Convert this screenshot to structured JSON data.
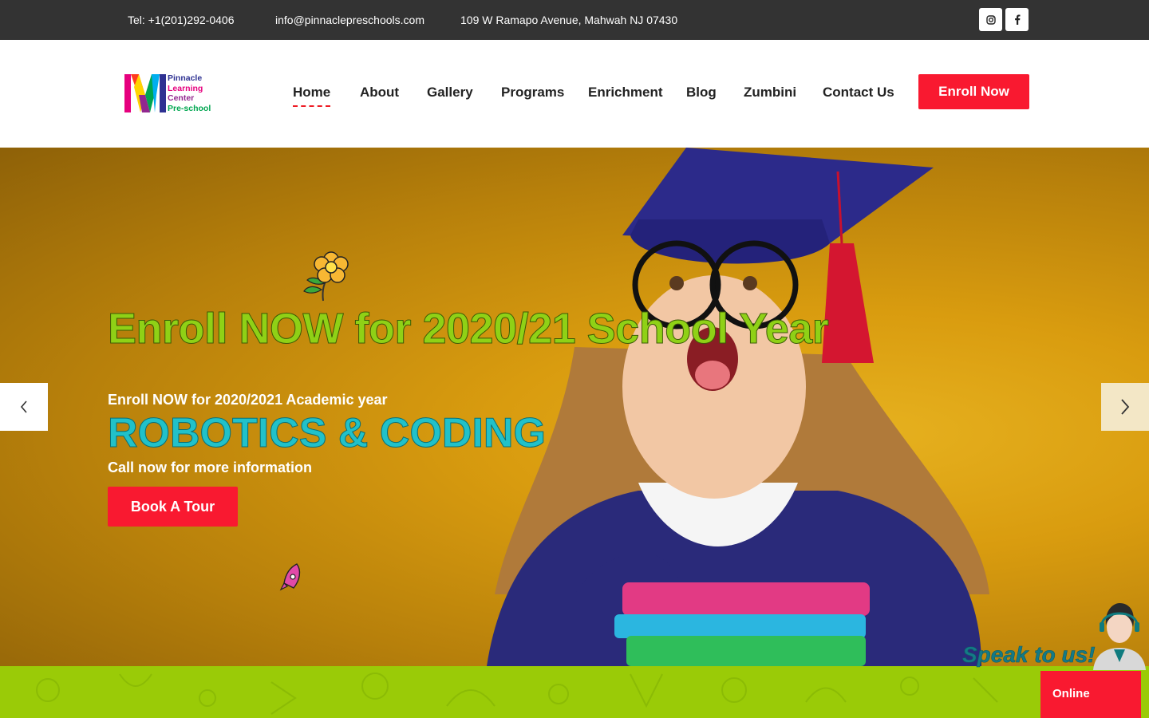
{
  "topbar": {
    "phone": "Tel: +1(201)292-0406",
    "email": "info@pinnaclepreschools.com",
    "address": "109 W Ramapo Avenue, Mahwah NJ 07430",
    "social": [
      "instagram-icon",
      "facebook-icon"
    ]
  },
  "logo": {
    "line1": "Pinnacle",
    "line2": "Learning",
    "line3": "Center",
    "line4": "Pre-school"
  },
  "nav": {
    "items": [
      {
        "label": "Home",
        "active": true
      },
      {
        "label": "About"
      },
      {
        "label": "Gallery"
      },
      {
        "label": "Programs"
      },
      {
        "label": "Enrichment"
      },
      {
        "label": "Blog"
      },
      {
        "label": "Zumbini"
      },
      {
        "label": "Contact Us"
      }
    ],
    "cta": "Enroll Now"
  },
  "hero": {
    "title": "Enroll NOW for 2020/21 School Year",
    "subtitle": "Enroll NOW for 2020/2021 Academic year",
    "highlight": "ROBOTICS & CODING",
    "call_text": "Call now for more information",
    "button": "Book A Tour",
    "prev_icon": "chevron-left-icon",
    "next_icon": "chevron-right-icon"
  },
  "chat": {
    "speak": "Speak to us!",
    "status": "Online"
  },
  "colors": {
    "accent_red": "#f91930",
    "topbar_bg": "#333333",
    "band_green": "#9acb07",
    "title_green": "#8fd116",
    "teal": "#21c1c9"
  }
}
